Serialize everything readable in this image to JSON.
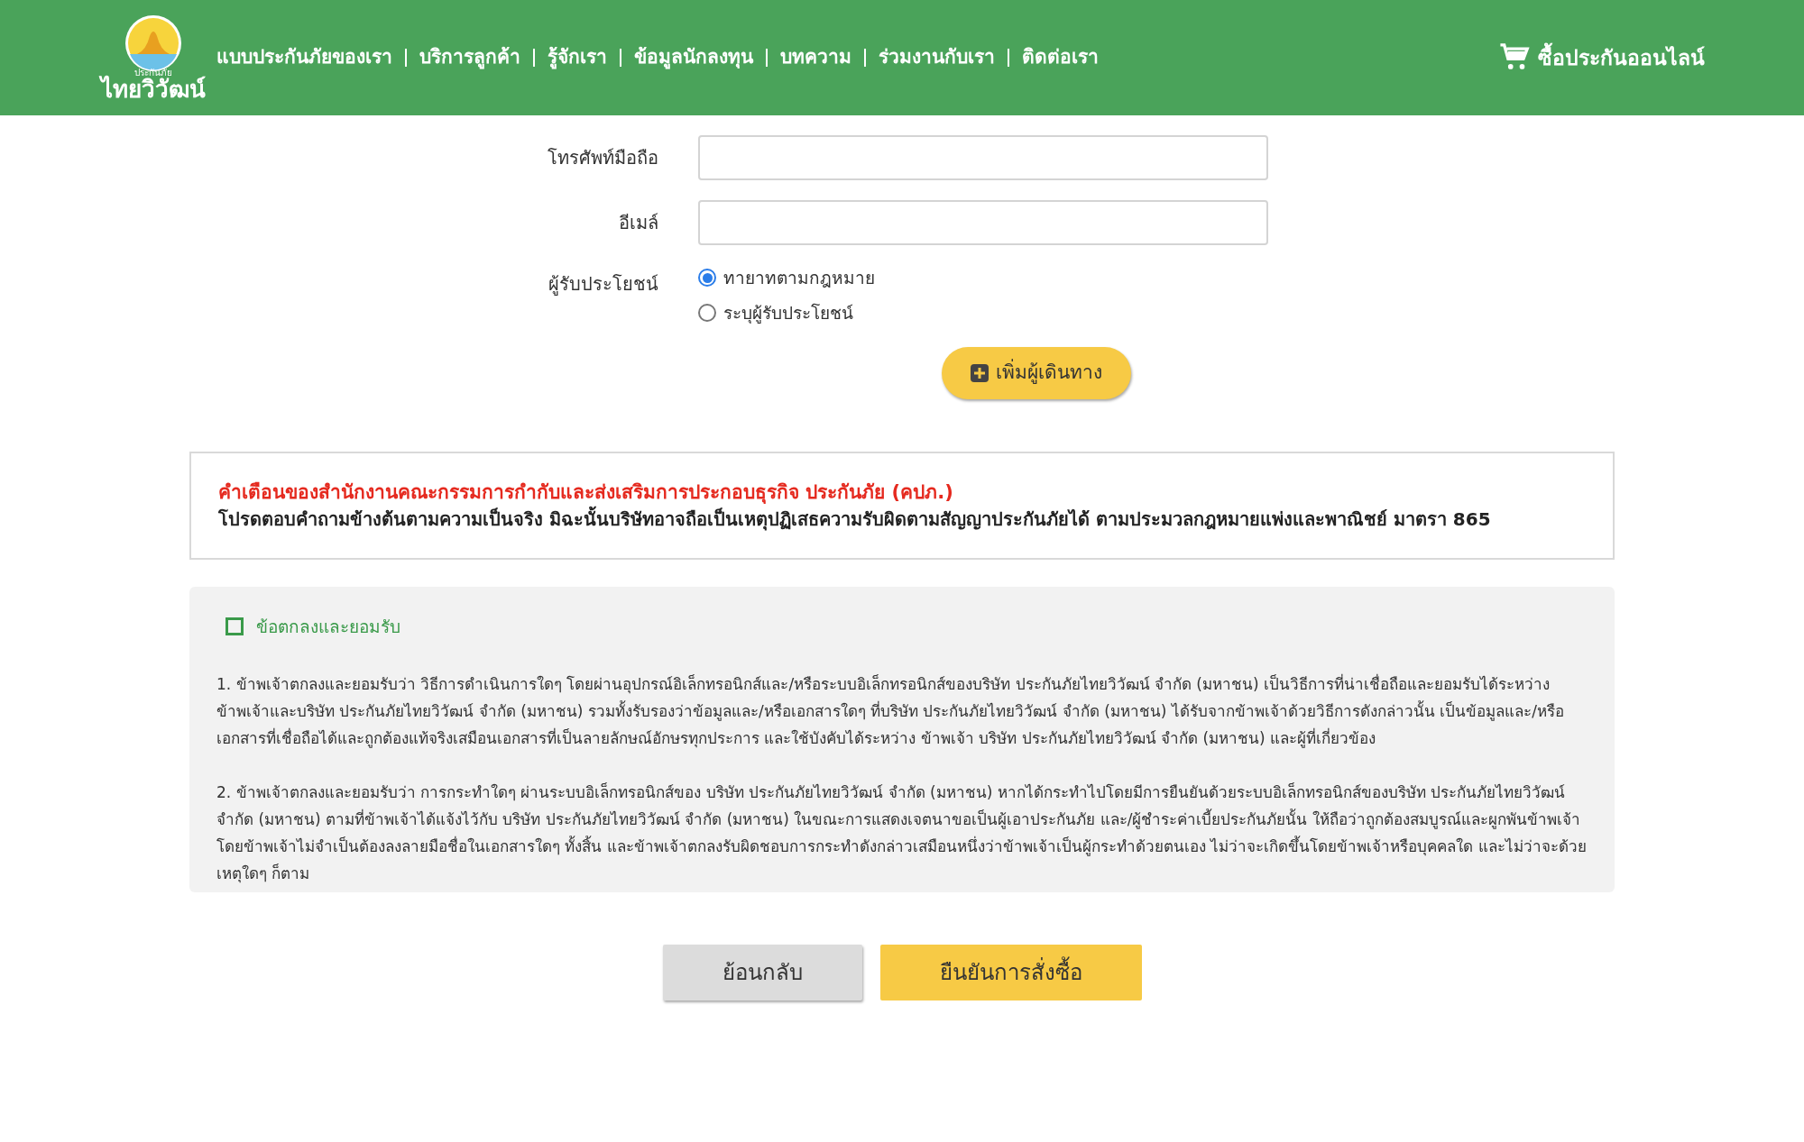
{
  "header": {
    "logo": {
      "small_text": "ประกันภัย",
      "name": "ไทยวิวัฒน์"
    },
    "nav": [
      {
        "label": "แบบประกันภัยของเรา"
      },
      {
        "label": "บริการลูกค้า"
      },
      {
        "label": "รู้จักเรา"
      },
      {
        "label": "ข้อมูลนักลงทุน"
      },
      {
        "label": "บทความ"
      },
      {
        "label": "ร่วมงานกับเรา"
      },
      {
        "label": "ติดต่อเรา"
      }
    ],
    "buy_online": "ซื้อประกันออนไลน์"
  },
  "form": {
    "fields": [
      {
        "label": "โทรศัพท์มือถือ"
      },
      {
        "label": "อีเมล์"
      }
    ],
    "beneficiary": {
      "label": "ผู้รับประโยชน์",
      "options": [
        {
          "label": "ทายาทตามกฎหมาย",
          "selected": true
        },
        {
          "label": "ระบุผู้รับประโยชน์",
          "selected": false
        }
      ]
    },
    "add_traveler": "เพิ่มผู้เดินทาง"
  },
  "warning": {
    "title": "คำเตือนของสำนักงานคณะกรรมการกำกับและส่งเสริมการประกอบธุรกิจ ประกันภัย (คปภ.)",
    "body": "โปรดตอบคำถามข้างต้นตามความเป็นจริง มิฉะนั้นบริษัทอาจถือเป็นเหตุปฏิเสธความรับผิดตามสัญญาประกันภัยได้ ตามประมวลกฎหมายแพ่งและพาณิชย์ มาตรา 865"
  },
  "terms": {
    "agree": {
      "label": "ข้อตกลงและยอมรับ",
      "checked": false
    },
    "paragraphs": [
      "1. ข้าพเจ้าตกลงและยอมรับว่า วิธีการดำเนินการใดๆ โดยผ่านอุปกรณ์อิเล็กทรอนิกส์และ/หรือระบบอิเล็กทรอนิกส์ของบริษัท ประกันภัยไทยวิวัฒน์ จำกัด (มหาชน) เป็นวิธีการที่น่าเชื่อถือและยอมรับได้ระหว่างข้าพเจ้าและบริษัท ประกันภัยไทยวิวัฒน์ จำกัด (มหาชน) รวมทั้งรับรองว่าข้อมูลและ/หรือเอกสารใดๆ ที่บริษัท ประกันภัยไทยวิวัฒน์ จำกัด (มหาชน) ได้รับจากข้าพเจ้าด้วยวิธีการดังกล่าวนั้น เป็นข้อมูลและ/หรือเอกสารที่เชื่อถือได้และถูกต้องแท้จริงเสมือนเอกสารที่เป็นลายลักษณ์อักษรทุกประการ และใช้บังคับได้ระหว่าง ข้าพเจ้า บริษัท ประกันภัยไทยวิวัฒน์ จำกัด (มหาชน) และผู้ที่เกี่ยวข้อง",
      "2. ข้าพเจ้าตกลงและยอมรับว่า การกระทำใดๆ ผ่านระบบอิเล็กทรอนิกส์ของ บริษัท ประกันภัยไทยวิวัฒน์ จำกัด (มหาชน) หากได้กระทำไปโดยมีการยืนยันด้วยระบบอิเล็กทรอนิกส์ของบริษัท ประกันภัยไทยวิวัฒน์ จำกัด (มหาชน) ตามที่ข้าพเจ้าได้แจ้งไว้กับ บริษัท ประกันภัยไทยวิวัฒน์ จำกัด (มหาชน) ในขณะการแสดงเจตนาขอเป็นผู้เอาประกันภัย และ/ผู้ชำระค่าเบี้ยประกันภัยนั้น ให้ถือว่าถูกต้องสมบูรณ์และผูกพันข้าพเจ้า โดยข้าพเจ้าไม่จำเป็นต้องลงลายมือชื่อในเอกสารใดๆ ทั้งสิ้น และข้าพเจ้าตกลงรับผิดชอบการกระทำดังกล่าวเสมือนหนึ่งว่าข้าพเจ้าเป็นผู้กระทำด้วยตนเอง ไม่ว่าจะเกิดขึ้นโดยข้าพเจ้าหรือบุคคลใด และไม่ว่าจะด้วยเหตุใดๆ ก็ตาม"
    ]
  },
  "actions": [
    {
      "label": "ย้อนกลับ",
      "kind": "secondary"
    },
    {
      "label": "ยืนยันการสั่งซื้อ",
      "kind": "primary"
    }
  ]
}
